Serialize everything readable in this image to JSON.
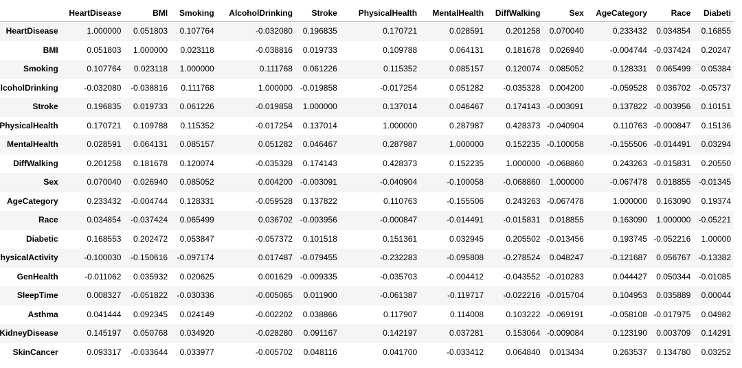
{
  "table": {
    "columns": [
      "HeartDisease",
      "BMI",
      "Smoking",
      "AlcoholDrinking",
      "Stroke",
      "PhysicalHealth",
      "MentalHealth",
      "DiffWalking",
      "Sex",
      "AgeCategory",
      "Race",
      "Diabeti"
    ],
    "rows": [
      {
        "label": "HeartDisease",
        "values": [
          "1.000000",
          "0.051803",
          "0.107764",
          "-0.032080",
          "0.196835",
          "0.170721",
          "0.028591",
          "0.201258",
          "0.070040",
          "0.233432",
          "0.034854",
          "0.16855"
        ]
      },
      {
        "label": "BMI",
        "values": [
          "0.051803",
          "1.000000",
          "0.023118",
          "-0.038816",
          "0.019733",
          "0.109788",
          "0.064131",
          "0.181678",
          "0.026940",
          "-0.004744",
          "-0.037424",
          "0.20247"
        ]
      },
      {
        "label": "Smoking",
        "values": [
          "0.107764",
          "0.023118",
          "1.000000",
          "0.111768",
          "0.061226",
          "0.115352",
          "0.085157",
          "0.120074",
          "0.085052",
          "0.128331",
          "0.065499",
          "0.05384"
        ]
      },
      {
        "label": "AlcoholDrinking",
        "values": [
          "-0.032080",
          "-0.038816",
          "0.111768",
          "1.000000",
          "-0.019858",
          "-0.017254",
          "0.051282",
          "-0.035328",
          "0.004200",
          "-0.059528",
          "0.036702",
          "-0.05737"
        ]
      },
      {
        "label": "Stroke",
        "values": [
          "0.196835",
          "0.019733",
          "0.061226",
          "-0.019858",
          "1.000000",
          "0.137014",
          "0.046467",
          "0.174143",
          "-0.003091",
          "0.137822",
          "-0.003956",
          "0.10151"
        ]
      },
      {
        "label": "PhysicalHealth",
        "values": [
          "0.170721",
          "0.109788",
          "0.115352",
          "-0.017254",
          "0.137014",
          "1.000000",
          "0.287987",
          "0.428373",
          "-0.040904",
          "0.110763",
          "-0.000847",
          "0.15136"
        ]
      },
      {
        "label": "MentalHealth",
        "values": [
          "0.028591",
          "0.064131",
          "0.085157",
          "0.051282",
          "0.046467",
          "0.287987",
          "1.000000",
          "0.152235",
          "-0.100058",
          "-0.155506",
          "-0.014491",
          "0.03294"
        ]
      },
      {
        "label": "DiffWalking",
        "values": [
          "0.201258",
          "0.181678",
          "0.120074",
          "-0.035328",
          "0.174143",
          "0.428373",
          "0.152235",
          "1.000000",
          "-0.068860",
          "0.243263",
          "-0.015831",
          "0.20550"
        ]
      },
      {
        "label": "Sex",
        "values": [
          "0.070040",
          "0.026940",
          "0.085052",
          "0.004200",
          "-0.003091",
          "-0.040904",
          "-0.100058",
          "-0.068860",
          "1.000000",
          "-0.067478",
          "0.018855",
          "-0.01345"
        ]
      },
      {
        "label": "AgeCategory",
        "values": [
          "0.233432",
          "-0.004744",
          "0.128331",
          "-0.059528",
          "0.137822",
          "0.110763",
          "-0.155506",
          "0.243263",
          "-0.067478",
          "1.000000",
          "0.163090",
          "0.19374"
        ]
      },
      {
        "label": "Race",
        "values": [
          "0.034854",
          "-0.037424",
          "0.065499",
          "0.036702",
          "-0.003956",
          "-0.000847",
          "-0.014491",
          "-0.015831",
          "0.018855",
          "0.163090",
          "1.000000",
          "-0.05221"
        ]
      },
      {
        "label": "Diabetic",
        "values": [
          "0.168553",
          "0.202472",
          "0.053847",
          "-0.057372",
          "0.101518",
          "0.151361",
          "0.032945",
          "0.205502",
          "-0.013456",
          "0.193745",
          "-0.052216",
          "1.00000"
        ]
      },
      {
        "label": "PhysicalActivity",
        "values": [
          "-0.100030",
          "-0.150616",
          "-0.097174",
          "0.017487",
          "-0.079455",
          "-0.232283",
          "-0.095808",
          "-0.278524",
          "0.048247",
          "-0.121687",
          "0.056767",
          "-0.13382"
        ]
      },
      {
        "label": "GenHealth",
        "values": [
          "-0.011062",
          "0.035932",
          "0.020625",
          "0.001629",
          "-0.009335",
          "-0.035703",
          "-0.004412",
          "-0.043552",
          "-0.010283",
          "0.044427",
          "0.050344",
          "-0.01085"
        ]
      },
      {
        "label": "SleepTime",
        "values": [
          "0.008327",
          "-0.051822",
          "-0.030336",
          "-0.005065",
          "0.011900",
          "-0.061387",
          "-0.119717",
          "-0.022216",
          "-0.015704",
          "0.104953",
          "0.035889",
          "0.00044"
        ]
      },
      {
        "label": "Asthma",
        "values": [
          "0.041444",
          "0.092345",
          "0.024149",
          "-0.002202",
          "0.038866",
          "0.117907",
          "0.114008",
          "0.103222",
          "-0.069191",
          "-0.058108",
          "-0.017975",
          "0.04982"
        ]
      },
      {
        "label": "KidneyDisease",
        "values": [
          "0.145197",
          "0.050768",
          "0.034920",
          "-0.028280",
          "0.091167",
          "0.142197",
          "0.037281",
          "0.153064",
          "-0.009084",
          "0.123190",
          "0.003709",
          "0.14291"
        ]
      },
      {
        "label": "SkinCancer",
        "values": [
          "0.093317",
          "-0.033644",
          "0.033977",
          "-0.005702",
          "0.048116",
          "0.041700",
          "-0.033412",
          "0.064840",
          "0.013434",
          "0.263537",
          "0.134780",
          "0.03252"
        ]
      }
    ]
  }
}
